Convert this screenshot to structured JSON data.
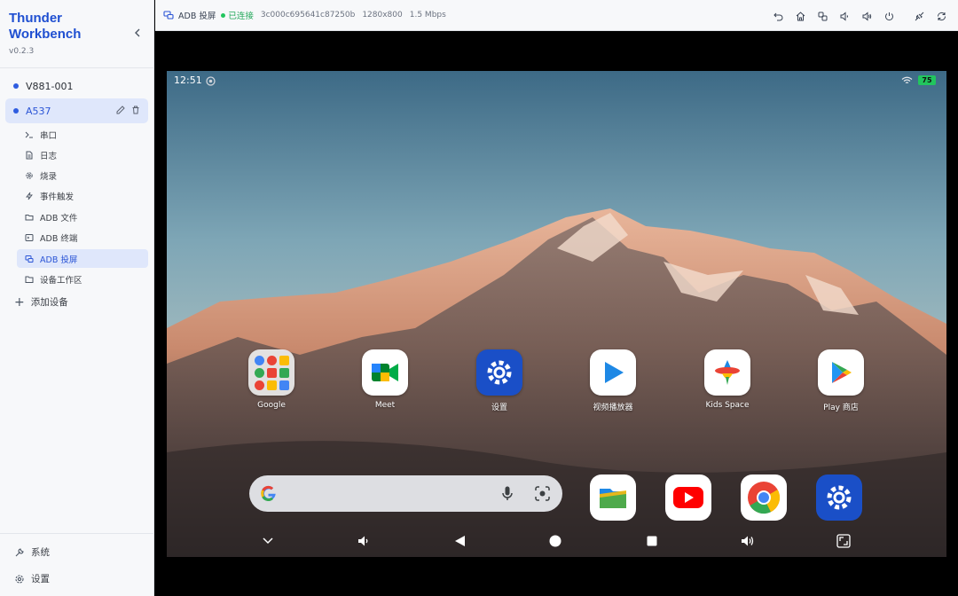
{
  "sidebar": {
    "brand_line1": "Thunder",
    "brand_line2": "Workbench",
    "version": "v0.2.3",
    "devices": [
      {
        "label": "V881-001"
      },
      {
        "label": "A537"
      }
    ],
    "subitems": [
      {
        "label": "串口",
        "icon": "terminal-icon"
      },
      {
        "label": "日志",
        "icon": "document-icon"
      },
      {
        "label": "烧录",
        "icon": "gear-icon"
      },
      {
        "label": "事件触发",
        "icon": "lightning-icon"
      },
      {
        "label": "ADB 文件",
        "icon": "folder-open-icon"
      },
      {
        "label": "ADB 终端",
        "icon": "terminal-box-icon"
      },
      {
        "label": "ADB 投屏",
        "icon": "cast-icon"
      },
      {
        "label": "设备工作区",
        "icon": "folder-icon"
      }
    ],
    "add_device": "添加设备",
    "bottom": [
      {
        "label": "系统",
        "icon": "wrench-icon"
      },
      {
        "label": "设置",
        "icon": "settings-icon"
      }
    ]
  },
  "topbar": {
    "title": "ADB 投屏",
    "status": "已连接",
    "serial": "3c000c695641c87250b",
    "resolution": "1280x800",
    "bitrate": "1.5 Mbps",
    "colors": {
      "connected": "#22c55e",
      "accent": "#2b55d6"
    }
  },
  "device_screen": {
    "time": "12:51",
    "battery": "75",
    "apps": [
      {
        "label": "Google"
      },
      {
        "label": "Meet"
      },
      {
        "label": "设置"
      },
      {
        "label": "视频播放器"
      },
      {
        "label": "Kids Space"
      },
      {
        "label": "Play 商店"
      }
    ]
  }
}
